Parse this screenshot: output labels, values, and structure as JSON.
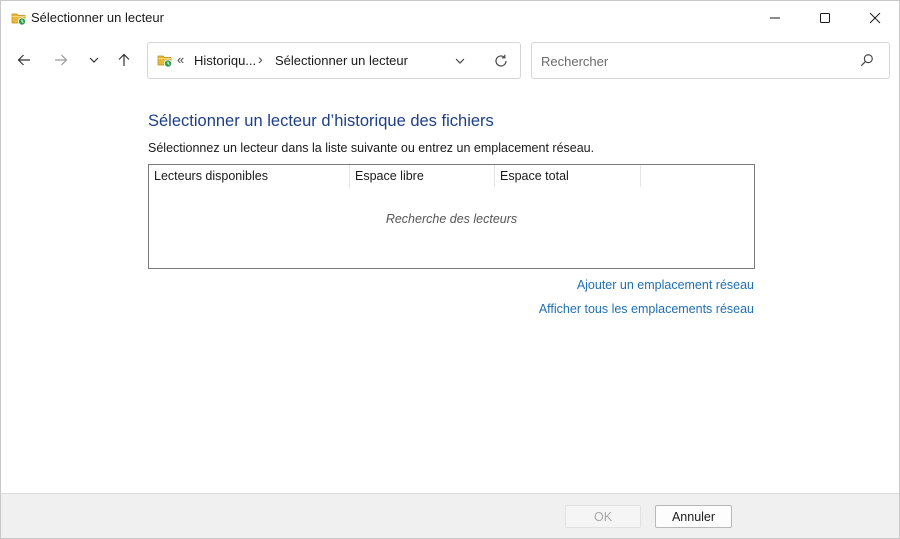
{
  "window": {
    "title": "Sélectionner un lecteur",
    "app_icon": "file-history-icon",
    "controls": {
      "minimize": "minimize-icon",
      "maximize": "maximize-icon",
      "close": "close-icon"
    }
  },
  "navbar": {
    "icons": {
      "back": "arrow-left-icon",
      "forward": "arrow-right-icon",
      "recent": "chevron-down-icon",
      "up": "arrow-up-icon",
      "refresh": "refresh-icon",
      "search": "search-icon"
    },
    "address": {
      "overflow": "«",
      "crumbs": [
        "Historiqu...",
        "Sélectionner un lecteur"
      ],
      "separator": "›"
    },
    "search": {
      "placeholder": "Rechercher"
    }
  },
  "main": {
    "heading": "Sélectionner un lecteur d’historique des fichiers",
    "instruction": "Sélectionnez un lecteur dans la liste suivante ou entrez un emplacement réseau.",
    "drive_list": {
      "columns": [
        "Lecteurs disponibles",
        "Espace libre",
        "Espace total"
      ],
      "status": "Recherche des lecteurs"
    },
    "links": {
      "add_network": "Ajouter un emplacement réseau",
      "show_network": "Afficher tous les emplacements réseau"
    }
  },
  "footer": {
    "ok_label": "OK",
    "cancel_label": "Annuler",
    "ok_enabled": false
  },
  "colors": {
    "heading": "#1e3f8a",
    "link": "#1f6fb5",
    "footer_bg": "#f0f0f0"
  }
}
